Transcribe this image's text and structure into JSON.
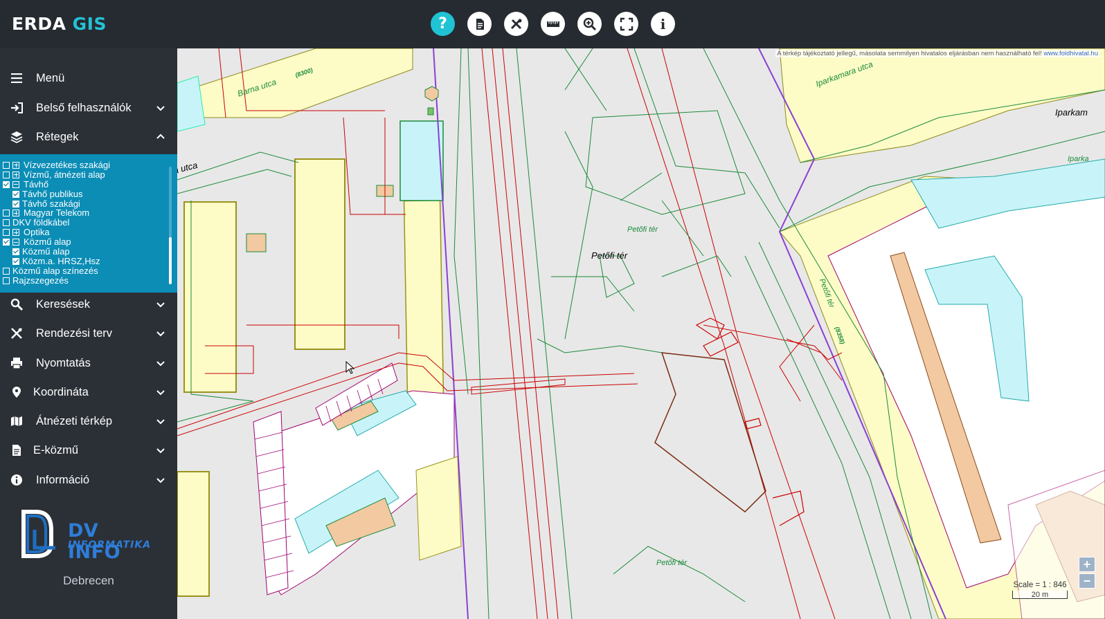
{
  "app": {
    "brand_main": "ERDA",
    "brand_accent": "GIS"
  },
  "toolbar": {
    "buttons": [
      {
        "icon": "help-icon",
        "glyph": "?"
      },
      {
        "icon": "document-icon",
        "glyph": ""
      },
      {
        "icon": "tools-icon",
        "glyph": ""
      },
      {
        "icon": "ruler-icon",
        "glyph": ""
      },
      {
        "icon": "zoom-icon",
        "glyph": ""
      },
      {
        "icon": "fullscreen-icon",
        "glyph": ""
      },
      {
        "icon": "info-icon",
        "glyph": "i"
      }
    ]
  },
  "sidebar": {
    "menu": "Menü",
    "belso": "Belső felhasználók",
    "retegek": "Rétegek",
    "kereses": "Keresések",
    "rendezesi": "Rendezési terv",
    "nyomtatas": "Nyomtatás",
    "koordinata": "Koordináta",
    "atnezeti": "Átnézeti térkép",
    "ekozmu": "E-közmű",
    "informacio": "Információ",
    "city": "Debrecen",
    "logo_line1": "DV INFO",
    "logo_line2": "INFORMATIKA"
  },
  "layers": [
    {
      "label": "Vízvezetékes szakági",
      "checked": false,
      "expander": "plus",
      "indent": 0
    },
    {
      "label": "Vízmű, átnézeti alap",
      "checked": false,
      "expander": "plus",
      "indent": 0
    },
    {
      "label": "Távhő",
      "checked": true,
      "expander": "minus",
      "indent": 0
    },
    {
      "label": "Távhő publikus",
      "checked": true,
      "expander": "none",
      "indent": 1
    },
    {
      "label": "Távhő szakági",
      "checked": true,
      "expander": "none",
      "indent": 1
    },
    {
      "label": "Magyar Telekom",
      "checked": false,
      "expander": "plus",
      "indent": 0
    },
    {
      "label": "DKV földkábel",
      "checked": false,
      "expander": "none",
      "indent": 0
    },
    {
      "label": "Optika",
      "checked": false,
      "expander": "plus",
      "indent": 0
    },
    {
      "label": "Közmű alap",
      "checked": true,
      "expander": "minus",
      "indent": 0
    },
    {
      "label": "Közmű alap",
      "checked": true,
      "expander": "none",
      "indent": 1
    },
    {
      "label": "Közm.a. HRSZ,Hsz",
      "checked": true,
      "expander": "none",
      "indent": 1
    },
    {
      "label": "Közmű alap színezés",
      "checked": false,
      "expander": "none",
      "indent": 0
    },
    {
      "label": "Rajzszegezés",
      "checked": false,
      "expander": "none",
      "indent": 0
    }
  ],
  "map": {
    "disclaimer": "A térkép tájékoztató jellegű, másolata semmilyen hivatalos eljárásban nem használható fel!",
    "disclaimer_link": "www.foldhivatal.hu",
    "labels": {
      "barna_utca": "Barna utca",
      "utca_left": "a utca",
      "iparkamara": "Iparkamara utca",
      "iparkam_right": "Iparkam",
      "ipark_green": "Iparka",
      "petofi_ter_main": "Petőfi tér",
      "petofi_ter_green1": "Petőfi tér",
      "petofi_ter_green2": "Petőfi tér",
      "petofi_ter_vertical": "Petőfi tér",
      "hrsz_8300": "(8300)",
      "hrsz_8358": "(8358)"
    },
    "scale_text": "Scale = 1 : 846",
    "scale_bar": "20 m",
    "zoom_in": "+",
    "zoom_out": "−"
  }
}
